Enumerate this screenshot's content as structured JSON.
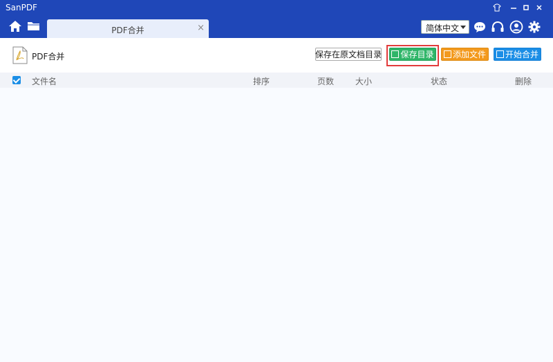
{
  "window": {
    "title": "SanPDF",
    "controls": [
      "shirt-icon",
      "minimize-icon",
      "maximize-icon",
      "close-icon"
    ]
  },
  "nav": {
    "icons": [
      "home-icon",
      "folder-icon"
    ]
  },
  "tab": {
    "label": "PDF合并",
    "close": "×"
  },
  "header_right": {
    "language": "简体中文",
    "icons": [
      "chat-icon",
      "headset-icon",
      "user-icon",
      "gear-icon"
    ]
  },
  "toolbar": {
    "page_title": "PDF合并",
    "buttons": {
      "save_in_original": "保存在原文档目录",
      "save_dir": "保存目录",
      "add_file": "添加文件",
      "start_merge": "开始合并"
    }
  },
  "table": {
    "columns": [
      "文件名",
      "排序",
      "页数",
      "大小",
      "状态",
      "删除"
    ]
  },
  "colors": {
    "titlebar": "#1f47b8",
    "green": "#2eb568",
    "orange": "#f39a1e",
    "blue": "#1b8ee6",
    "highlight": "#e23b3b"
  }
}
